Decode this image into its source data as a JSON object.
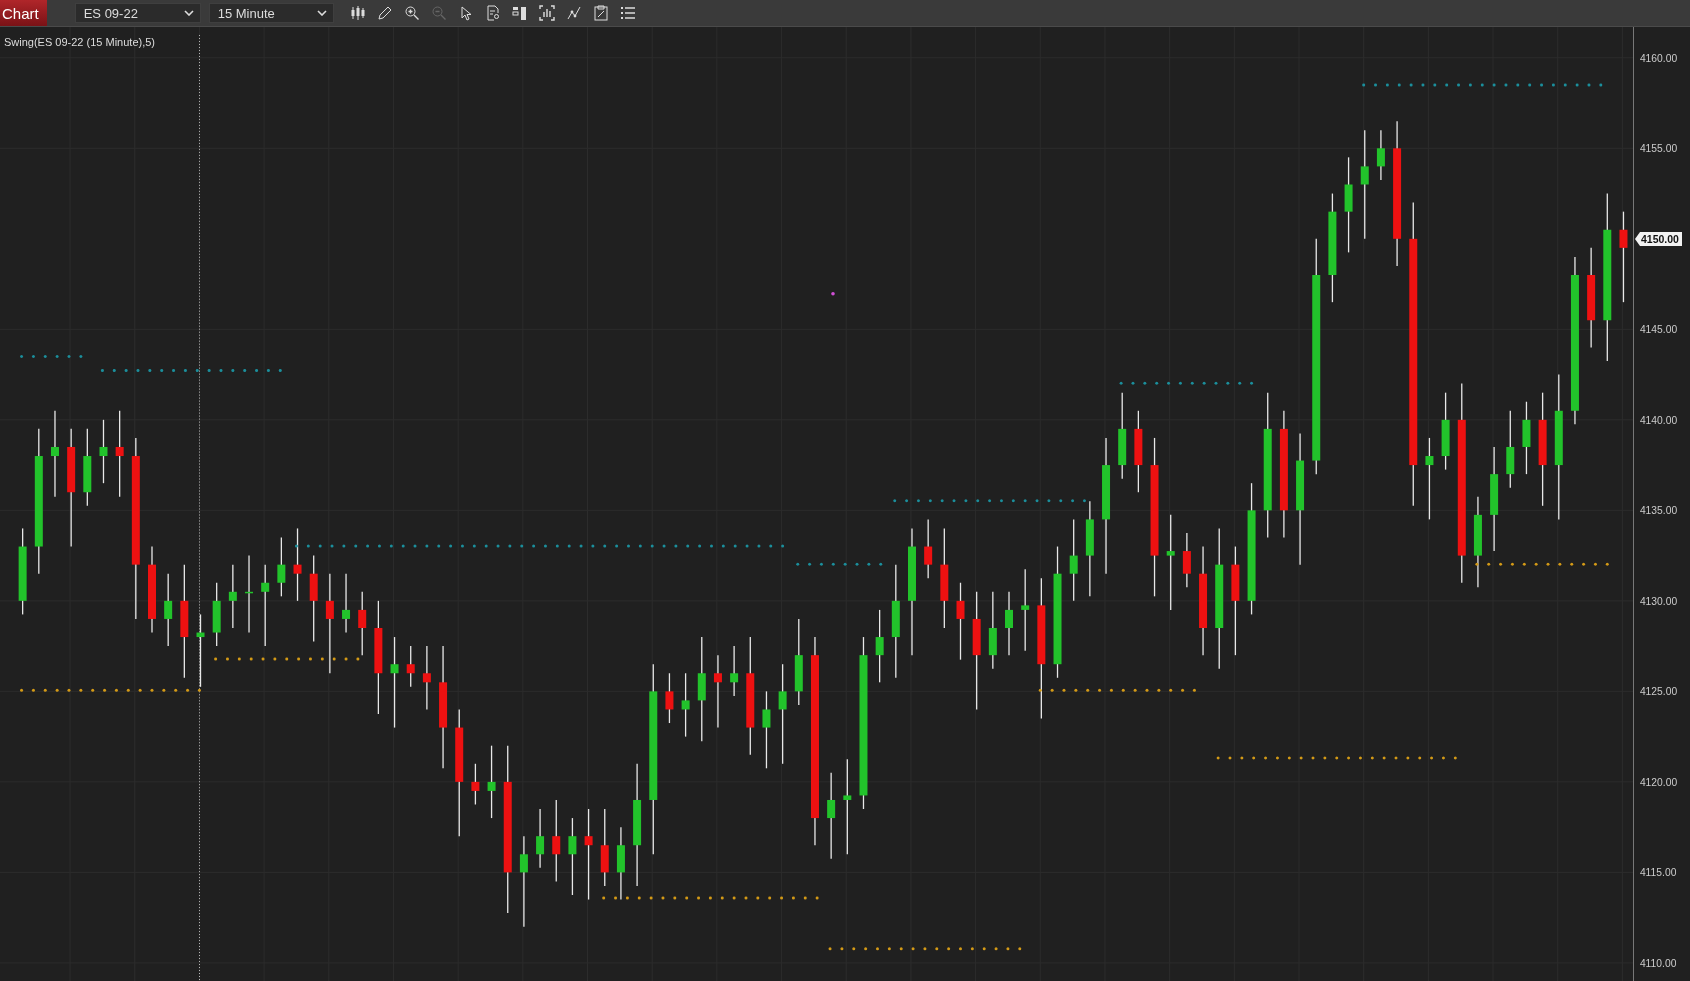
{
  "toolbar": {
    "tab": "Chart",
    "instrument": "ES 09-22",
    "interval": "15 Minute"
  },
  "chart": {
    "indicator_label": "Swing(ES 09-22 (15 Minute),5)",
    "current_price": "4150.00",
    "chart_data": {
      "type": "candlestick",
      "grid": true,
      "ohlc": [
        [
          4130,
          4134,
          4129.25,
          4133
        ],
        [
          4133,
          4139.5,
          4131.5,
          4138
        ],
        [
          4138,
          4140.5,
          4135.75,
          4138.5
        ],
        [
          4138.5,
          4139.5,
          4133,
          4136
        ],
        [
          4136,
          4139.5,
          4135.25,
          4138
        ],
        [
          4138,
          4140,
          4136.5,
          4138.5
        ],
        [
          4138.5,
          4140.5,
          4135.75,
          4138
        ],
        [
          4138,
          4139,
          4129,
          4132
        ],
        [
          4132,
          4133,
          4128.25,
          4129
        ],
        [
          4129,
          4131.5,
          4127.5,
          4130
        ],
        [
          4130,
          4132,
          4125.75,
          4128
        ],
        [
          4128,
          4129.25,
          4125.25,
          4128.25
        ],
        [
          4128.25,
          4131,
          4127.5,
          4130
        ],
        [
          4130,
          4132,
          4128.5,
          4130.5
        ],
        [
          4130.5,
          4132.5,
          4128.25,
          4130.5
        ],
        [
          4130.5,
          4132,
          4127.5,
          4131
        ],
        [
          4131,
          4133.5,
          4130.25,
          4132
        ],
        [
          4132,
          4134,
          4130,
          4131.5
        ],
        [
          4131.5,
          4132.5,
          4127.75,
          4130
        ],
        [
          4130,
          4131.5,
          4126,
          4129
        ],
        [
          4129,
          4131.5,
          4128.25,
          4129.5
        ],
        [
          4129.5,
          4130.5,
          4127,
          4128.5
        ],
        [
          4128.5,
          4130,
          4123.75,
          4126
        ],
        [
          4126,
          4128,
          4123,
          4126.5
        ],
        [
          4126.5,
          4127.5,
          4125.25,
          4126
        ],
        [
          4126,
          4127.5,
          4124,
          4125.5
        ],
        [
          4125.5,
          4127.5,
          4120.75,
          4123
        ],
        [
          4123,
          4124,
          4117,
          4120
        ],
        [
          4120,
          4121,
          4118.75,
          4119.5
        ],
        [
          4119.5,
          4122,
          4118,
          4120
        ],
        [
          4120,
          4122,
          4112.75,
          4115
        ],
        [
          4115,
          4117,
          4112,
          4116
        ],
        [
          4116,
          4118.5,
          4115.25,
          4117
        ],
        [
          4117,
          4119,
          4114.5,
          4116
        ],
        [
          4116,
          4118,
          4113.75,
          4117
        ],
        [
          4117,
          4118.5,
          4113.5,
          4116.5
        ],
        [
          4116.5,
          4118.5,
          4114.25,
          4115
        ],
        [
          4115,
          4117.5,
          4113.5,
          4116.5
        ],
        [
          4116.5,
          4121,
          4114.25,
          4119
        ],
        [
          4119,
          4126.5,
          4116,
          4125
        ],
        [
          4125,
          4126,
          4123.25,
          4124
        ],
        [
          4124,
          4126,
          4122.5,
          4124.5
        ],
        [
          4124.5,
          4128,
          4122.25,
          4126
        ],
        [
          4126,
          4127,
          4123,
          4125.5
        ],
        [
          4125.5,
          4127.5,
          4124.75,
          4126
        ],
        [
          4126,
          4128,
          4121.5,
          4123
        ],
        [
          4123,
          4125,
          4120.75,
          4124
        ],
        [
          4124,
          4126.5,
          4121,
          4125
        ],
        [
          4125,
          4129,
          4124.25,
          4127
        ],
        [
          4127,
          4128,
          4116.5,
          4118
        ],
        [
          4118,
          4120.5,
          4115.75,
          4119
        ],
        [
          4119,
          4121.25,
          4116,
          4119.25
        ],
        [
          4119.25,
          4128,
          4118.5,
          4127
        ],
        [
          4127,
          4129.5,
          4125.5,
          4128
        ],
        [
          4128,
          4132,
          4125.75,
          4130
        ],
        [
          4130,
          4134,
          4127,
          4133
        ],
        [
          4133,
          4134.5,
          4131.25,
          4132
        ],
        [
          4132,
          4134,
          4128.5,
          4130
        ],
        [
          4130,
          4131,
          4126.75,
          4129
        ],
        [
          4129,
          4130.5,
          4124,
          4127
        ],
        [
          4127,
          4130.5,
          4126.25,
          4128.5
        ],
        [
          4128.5,
          4130.5,
          4127,
          4129.5
        ],
        [
          4129.5,
          4131.75,
          4127.25,
          4129.75
        ],
        [
          4129.75,
          4131.25,
          4123.5,
          4126.5
        ],
        [
          4126.5,
          4133,
          4125.75,
          4131.5
        ],
        [
          4131.5,
          4134.5,
          4130,
          4132.5
        ],
        [
          4132.5,
          4135.5,
          4130.25,
          4134.5
        ],
        [
          4134.5,
          4139,
          4131.5,
          4137.5
        ],
        [
          4137.5,
          4141.5,
          4136.75,
          4139.5
        ],
        [
          4139.5,
          4140.5,
          4136,
          4137.5
        ],
        [
          4137.5,
          4139,
          4130.25,
          4132.5
        ],
        [
          4132.5,
          4134.75,
          4129.5,
          4132.75
        ],
        [
          4132.75,
          4133.75,
          4130.75,
          4131.5
        ],
        [
          4131.5,
          4133,
          4127,
          4128.5
        ],
        [
          4128.5,
          4134,
          4126.25,
          4132
        ],
        [
          4132,
          4133,
          4127,
          4130
        ],
        [
          4130,
          4136.5,
          4129.25,
          4135
        ],
        [
          4135,
          4141.5,
          4133.5,
          4139.5
        ],
        [
          4139.5,
          4140.5,
          4133.5,
          4135
        ],
        [
          4135,
          4139.25,
          4132,
          4137.75
        ],
        [
          4137.75,
          4150,
          4137,
          4148
        ],
        [
          4148,
          4152.5,
          4146.5,
          4151.5
        ],
        [
          4151.5,
          4154.5,
          4149.25,
          4153
        ],
        [
          4153,
          4156,
          4150,
          4154
        ],
        [
          4154,
          4156,
          4153.25,
          4155
        ],
        [
          4155,
          4156.5,
          4148.5,
          4150
        ],
        [
          4150,
          4152,
          4135.25,
          4137.5
        ],
        [
          4137.5,
          4139,
          4134.5,
          4138
        ],
        [
          4138,
          4141.5,
          4137.25,
          4140
        ],
        [
          4140,
          4142,
          4131,
          4132.5
        ],
        [
          4132.5,
          4135.75,
          4130.75,
          4134.75
        ],
        [
          4134.75,
          4138.5,
          4132.75,
          4137
        ],
        [
          4137,
          4140.5,
          4136.25,
          4138.5
        ],
        [
          4138.5,
          4141,
          4137,
          4140
        ],
        [
          4140,
          4141.5,
          4135.25,
          4137.5
        ],
        [
          4137.5,
          4142.5,
          4134.5,
          4140.5
        ],
        [
          4140.5,
          4149,
          4139.75,
          4148
        ],
        [
          4148,
          4149.5,
          4144,
          4145.5
        ],
        [
          4145.5,
          4152.5,
          4143.25,
          4150.5
        ],
        [
          4150.5,
          4151.5,
          4146.5,
          4149.5
        ]
      ],
      "ylim": [
        4109,
        4161.7
      ],
      "yticks": [
        {
          "value": 4160,
          "label": "4160.00"
        },
        {
          "value": 4155,
          "label": "4155.00"
        },
        {
          "value": 4145,
          "label": "4145.00"
        },
        {
          "value": 4140,
          "label": "4140.00"
        },
        {
          "value": 4135,
          "label": "4135.00"
        },
        {
          "value": 4130,
          "label": "4130.00"
        },
        {
          "value": 4125,
          "label": "4125.00"
        },
        {
          "value": 4120,
          "label": "4120.00"
        },
        {
          "value": 4115,
          "label": "4115.00"
        },
        {
          "value": 4110,
          "label": "4110.00"
        }
      ]
    }
  }
}
